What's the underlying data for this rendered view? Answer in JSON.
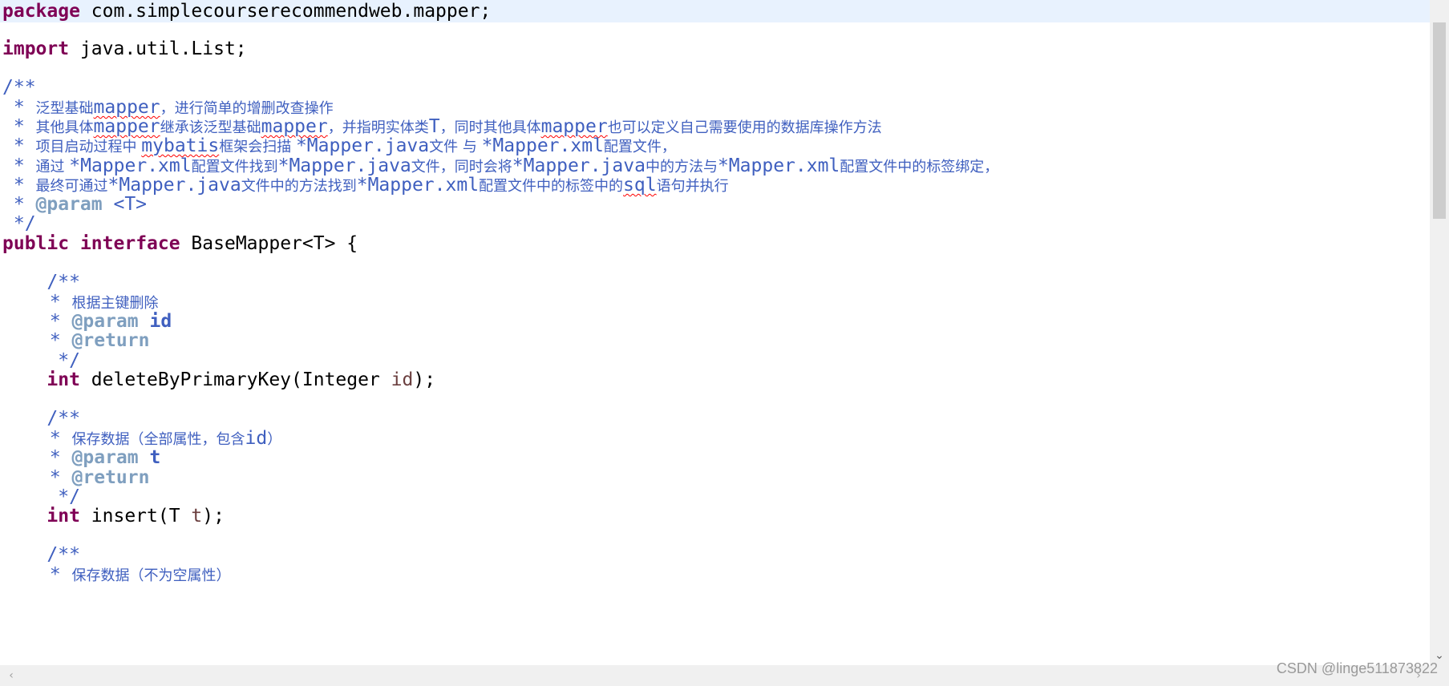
{
  "code": {
    "package_kw": "package",
    "package_name": " com.simplecourserecommendweb.mapper;",
    "import_kw": "import",
    "import_name": " java.util.List;",
    "doc_open": "/**",
    "doc_line1_star": " * ",
    "doc_line1_a": "泛型基础",
    "doc_line1_b": "mapper",
    "doc_line1_c": "，进行简单的增删改查操作",
    "doc_line2_a": "其他具体",
    "doc_line2_b": "mapper",
    "doc_line2_c": "继承该泛型基础",
    "doc_line2_d": "mapper",
    "doc_line2_e": "，并指明实体类",
    "doc_line2_f": "T",
    "doc_line2_g": "，同时其他具体",
    "doc_line2_h": "mapper",
    "doc_line2_i": "也可以定义自己需要使用的数据库操作方法",
    "doc_line3_a": "项目启动过程中 ",
    "doc_line3_b": "mybatis",
    "doc_line3_c": "框架会扫描 ",
    "doc_line3_d": "*Mapper.java",
    "doc_line3_e": "文件 与 ",
    "doc_line3_f": "*Mapper.xml",
    "doc_line3_g": "配置文件，",
    "doc_line4_a": "通过 ",
    "doc_line4_b": "*Mapper.xml",
    "doc_line4_c": "配置文件找到",
    "doc_line4_d": "*Mapper.java",
    "doc_line4_e": "文件，同时会将",
    "doc_line4_f": "*Mapper.java",
    "doc_line4_g": "中的方法与",
    "doc_line4_h": "*Mapper.xml",
    "doc_line4_i": "配置文件中的标签绑定，",
    "doc_line5_a": "最终可通过",
    "doc_line5_b": "*Mapper.java",
    "doc_line5_c": "文件中的方法找到",
    "doc_line5_d": "*Mapper.xml",
    "doc_line5_e": "配置文件中的标签中的",
    "doc_line5_f": "sql",
    "doc_line5_g": "语句并执行",
    "doc_param_tag": "@param",
    "doc_param_val": " <T>",
    "doc_close": " */",
    "iface_public": "public",
    "iface_interface": "interface",
    "iface_decl": " BaseMapper<T> {",
    "m1_doc_open": "    /**",
    "m1_desc": "根据主键删除",
    "m1_param_tag": "@param",
    "m1_param_val": " id",
    "m1_return_tag": "@return",
    "m1_doc_close": "     */",
    "m1_ret_type": "int",
    "m1_sig_a": " deleteByPrimaryKey(Integer ",
    "m1_sig_param": "id",
    "m1_sig_b": ");",
    "m2_doc_open": "    /**",
    "m2_desc_a": "保存数据（全部属性，包含",
    "m2_desc_b": "id",
    "m2_desc_c": "）",
    "m2_param_tag": "@param",
    "m2_param_val": " t",
    "m2_return_tag": "@return",
    "m2_doc_close": "     */",
    "m2_ret_type": "int",
    "m2_sig_a": " insert(T ",
    "m2_sig_param": "t",
    "m2_sig_b": ");",
    "m3_doc_open": "    /**",
    "m3_desc": "保存数据（不为空属性）"
  },
  "scroll": {
    "down_arrow": "⌄",
    "left_arrow": "‹",
    "right_arrow": "›"
  },
  "watermark": "CSDN @linge511873822",
  "colors": {
    "keyword": "#7f0055",
    "javadoc": "#3f5fbf",
    "javadoc_tag": "#7f9fbf",
    "parameter": "#6a3e3e",
    "current_line": "#e8f2fe"
  }
}
